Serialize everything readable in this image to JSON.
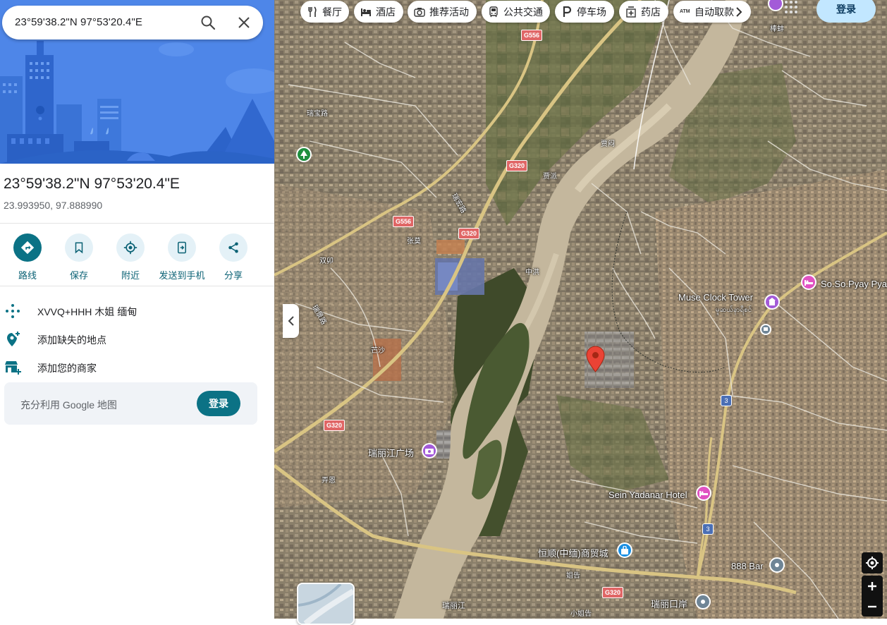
{
  "search": {
    "value": "23°59'38.2\"N 97°53'20.4\"E"
  },
  "place": {
    "title": "23°59'38.2\"N 97°53'20.4\"E",
    "decimal": "23.993950, 97.888990"
  },
  "actions": [
    {
      "label": "路线",
      "icon": "directions-icon"
    },
    {
      "label": "保存",
      "icon": "bookmark-icon"
    },
    {
      "label": "附近",
      "icon": "nearby-icon"
    },
    {
      "label": "发送到手机",
      "icon": "send-to-phone-icon"
    },
    {
      "label": "分享",
      "icon": "share-icon"
    }
  ],
  "info": [
    {
      "text": "XVVQ+HHH 木姐 缅甸",
      "icon": "plus-code-icon"
    },
    {
      "text": "添加缺失的地点",
      "icon": "add-place-icon"
    },
    {
      "text": "添加您的商家",
      "icon": "add-business-icon"
    }
  ],
  "promo": {
    "text": "充分利用 Google 地图",
    "button": "登录"
  },
  "chips": [
    {
      "label": "餐厅",
      "icon": "restaurant-icon"
    },
    {
      "label": "酒店",
      "icon": "hotel-icon"
    },
    {
      "label": "推荐活动",
      "icon": "camera-icon"
    },
    {
      "label": "公共交通",
      "icon": "transit-icon"
    },
    {
      "label": "停车场",
      "icon": "parking-icon"
    },
    {
      "label": "药店",
      "icon": "pharmacy-icon"
    },
    {
      "label": "自动取款",
      "icon": "atm-icon"
    }
  ],
  "header": {
    "login": "登录"
  },
  "map_labels": {
    "muse_clock_tower": "Muse Clock Tower",
    "muse_clock_tower_local": "မူဆယ်နာရီစင်",
    "so_so_pyay": "So.So.Pyay Pya",
    "sein_yadanar": "Sein Yadanar Hotel",
    "ruilijiang_square": "瑞丽江广场",
    "hengshun": "恒顺(中缅)商贸城",
    "bar_888": "888 Bar",
    "ruili_port": "瑞丽口岸",
    "ruilijiang": "瑞丽江",
    "ruibao_road": "瑞宝路",
    "ruihong_road": "瑞宏路",
    "ruijing_road": "瑞景路",
    "zhangmo": "张莫",
    "shuangmao": "双卯",
    "mangsha": "芒沙",
    "nongen": "弄恩",
    "zhonghong": "中洪",
    "jiamen": "贾闷",
    "jiapai": "贾派",
    "jiegao": "姐告",
    "xiaojiegao": "小姐告",
    "bangkong": "棒蚌",
    "route_g556_a": "G556",
    "route_g556_b": "G556",
    "route_g320_a": "G320",
    "route_g320_b": "G320",
    "route_g320_c": "G320",
    "route_g320_d": "G320",
    "route_3_a": "3",
    "route_3_b": "3"
  },
  "colors": {
    "accent": "#0b7285",
    "hero_bg": "#4e86e8",
    "pin": "#ea4335"
  }
}
